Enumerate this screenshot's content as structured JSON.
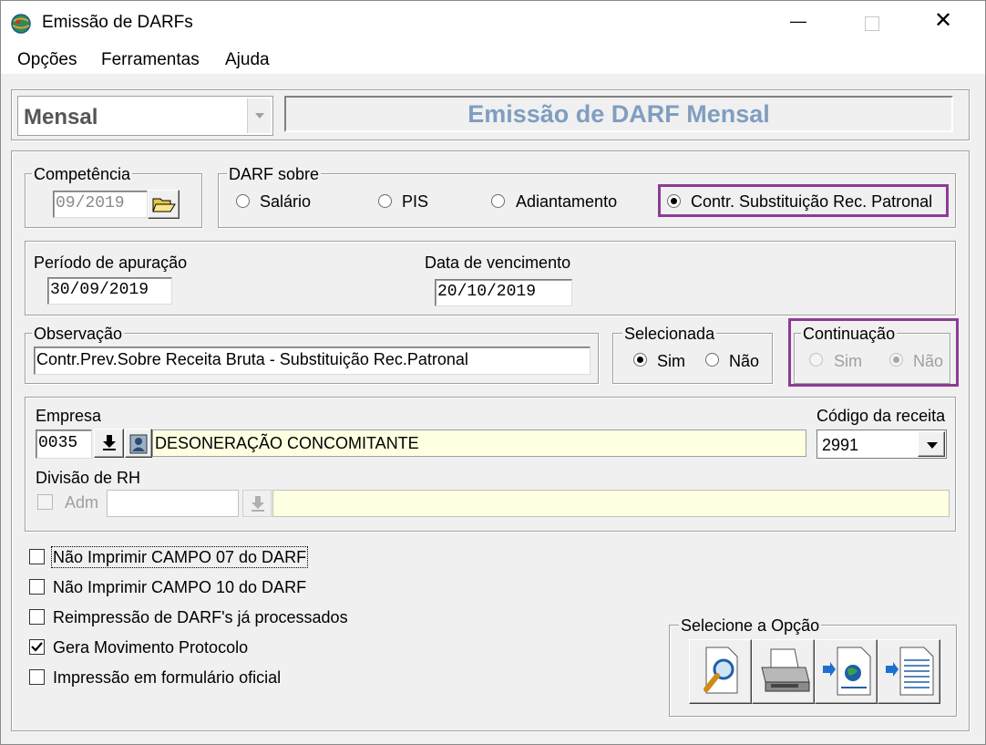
{
  "window": {
    "title": "Emissão de DARFs",
    "minimize_glyph": "—",
    "close_glyph": "✕"
  },
  "menu": [
    "Opções",
    "Ferramentas",
    "Ajuda"
  ],
  "header": {
    "mode_select_value": "Mensal",
    "banner_title": "Emissão de DARF Mensal"
  },
  "competencia": {
    "label": "Competência",
    "value": "09/2019"
  },
  "darf_sobre": {
    "label": "DARF sobre",
    "options": [
      "Salário",
      "PIS",
      "Adiantamento",
      "Contr. Substituição Rec. Patronal"
    ],
    "selected": "Contr. Substituição Rec. Patronal"
  },
  "periodo": {
    "label": "Período de apuração",
    "value": "30/09/2019"
  },
  "vencimento": {
    "label": "Data de vencimento",
    "value": "20/10/2019"
  },
  "observacao": {
    "label": "Observação",
    "value": "Contr.Prev.Sobre Receita Bruta - Substituição Rec.Patronal"
  },
  "selecionada": {
    "label": "Selecionada",
    "options": [
      "Sim",
      "Não"
    ],
    "selected": "Sim"
  },
  "continuacao": {
    "label": "Continuação",
    "options": [
      "Sim",
      "Não"
    ],
    "selected": "Não",
    "enabled": false
  },
  "empresa": {
    "label": "Empresa",
    "code": "0035",
    "name": "DESONERAÇÃO CONCOMITANTE"
  },
  "codigo_receita": {
    "label": "Código da receita",
    "value": "2991"
  },
  "divisao": {
    "label": "Divisão de RH",
    "adm_label": "Adm",
    "value": "",
    "description": ""
  },
  "checkboxes": [
    {
      "label": "Não Imprimir CAMPO 07 do DARF",
      "checked": false
    },
    {
      "label": "Não Imprimir CAMPO 10 do DARF",
      "checked": false
    },
    {
      "label": "Reimpressão de DARF's já processados",
      "checked": false
    },
    {
      "label": "Gera Movimento Protocolo",
      "checked": true
    },
    {
      "label": "Impressão em formulário oficial",
      "checked": false
    }
  ],
  "actions": {
    "label": "Selecione a Opção",
    "buttons": [
      {
        "icon": "preview-magnifier-icon"
      },
      {
        "icon": "printer-icon"
      },
      {
        "icon": "export-web-document-icon"
      },
      {
        "icon": "export-text-document-icon"
      }
    ]
  },
  "colors": {
    "highlight": "#8e3b96",
    "banner_text": "#7f9ec0",
    "readonly_yellow": "#ffffe1"
  }
}
